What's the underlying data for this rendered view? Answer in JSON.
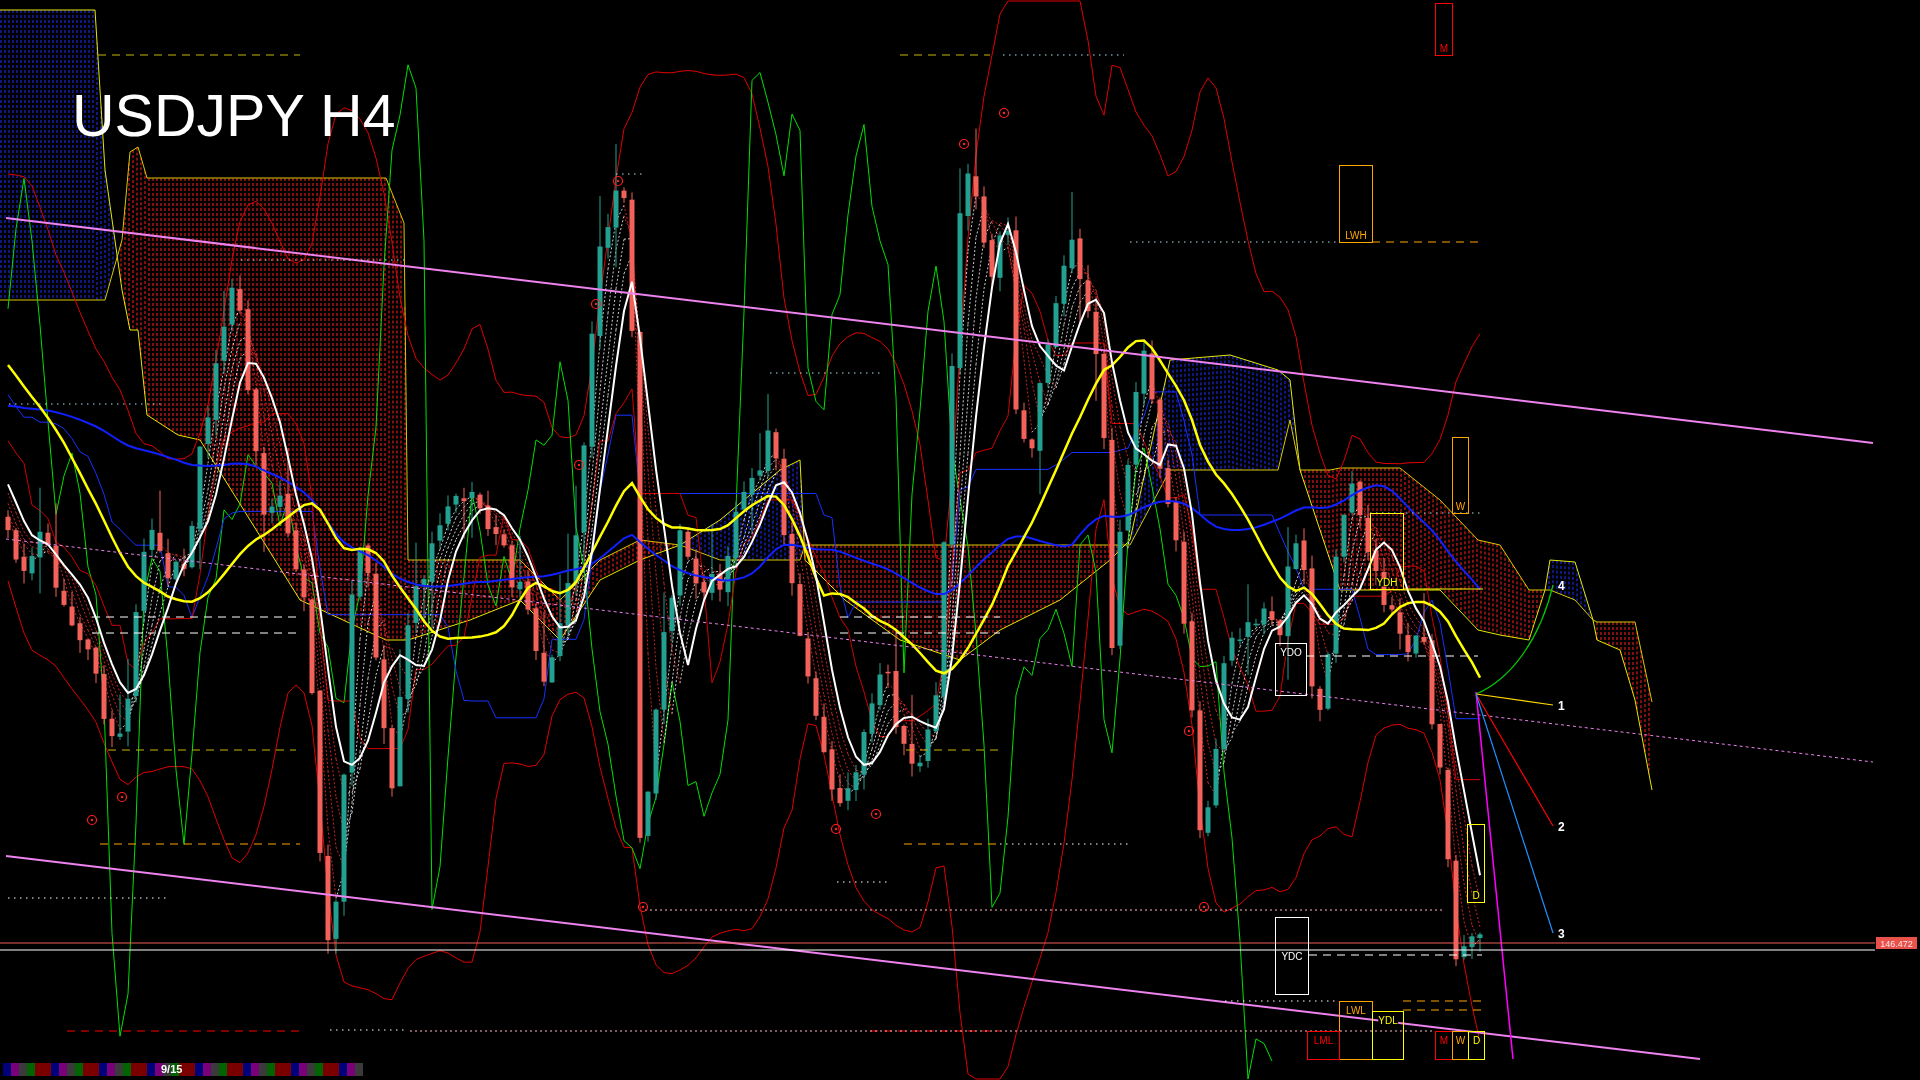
{
  "chart": {
    "title": "USDJPY H4",
    "price_label": "146.472"
  },
  "levels": [
    {
      "label": "M",
      "color": "#ff0000"
    },
    {
      "label": "LWH",
      "color": "#ffa500"
    },
    {
      "label": "W",
      "color": "#ffa500"
    },
    {
      "label": "YDH",
      "color": "#ffff00"
    },
    {
      "label": "YDO",
      "color": "#ffffff"
    },
    {
      "label": "D",
      "color": "#ffff00"
    },
    {
      "label": "YDC",
      "color": "#ffffff"
    },
    {
      "label": "LWL",
      "color": "#ffa500"
    },
    {
      "label": "YDL",
      "color": "#ffff00"
    },
    {
      "label": "LML",
      "color": "#ff0000"
    },
    {
      "label": "M",
      "color": "#ff0000"
    },
    {
      "label": "W",
      "color": "#ffa500"
    },
    {
      "label": "D",
      "color": "#ffff00"
    }
  ],
  "projections": [
    {
      "label": "4",
      "color": "#00c800"
    },
    {
      "label": "1",
      "color": "#ffd700"
    },
    {
      "label": "2",
      "color": "#ff0000"
    },
    {
      "label": "3",
      "color": "#1e90ff"
    }
  ],
  "status_strip": {
    "page": "9/15"
  }
}
